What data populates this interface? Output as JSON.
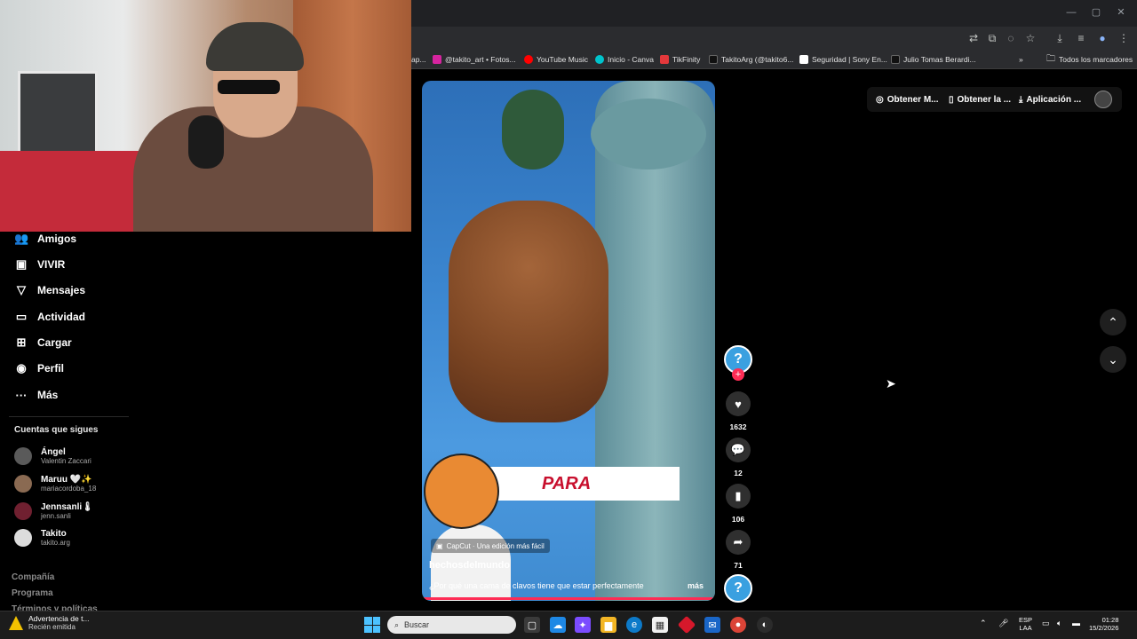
{
  "browser": {
    "bookmarks": [
      {
        "label": "ap...",
        "color": "#5f6368"
      },
      {
        "label": "@takito_art • Fotos...",
        "color": "#d6249f"
      },
      {
        "label": "YouTube Music",
        "color": "#ff0000"
      },
      {
        "label": "Inicio - Canva",
        "color": "#00c4cc"
      },
      {
        "label": "TikFinity",
        "color": "#e3383b"
      },
      {
        "label": "TakitoArg (@takito6...",
        "color": "#111111"
      },
      {
        "label": "Seguridad | Sony En...",
        "color": "#ffffff"
      },
      {
        "label": "Julio Tomas Berardi...",
        "color": "#111111"
      }
    ],
    "bookmarks_more": "»",
    "all_bookmarks": "Todos los marcadores"
  },
  "sidebar": {
    "items": [
      {
        "label": "Amigos",
        "icon": "friends-icon",
        "glyph": "👥"
      },
      {
        "label": "VIVIR",
        "icon": "live-icon",
        "glyph": "▣"
      },
      {
        "label": "Mensajes",
        "icon": "messages-icon",
        "glyph": "▽"
      },
      {
        "label": "Actividad",
        "icon": "activity-icon",
        "glyph": "▭"
      },
      {
        "label": "Cargar",
        "icon": "upload-icon",
        "glyph": "⊞"
      },
      {
        "label": "Perfil",
        "icon": "profile-icon",
        "glyph": "◉"
      },
      {
        "label": "Más",
        "icon": "more-icon",
        "glyph": "···"
      }
    ],
    "following_title": "Cuentas que sigues",
    "following": [
      {
        "name": "Ángel",
        "user": "Valentin Zaccari"
      },
      {
        "name": "Maruu 🤍✨",
        "user": "mariacordoba_18"
      },
      {
        "name": "Jennsanli🌡",
        "user": "jenn.sanli"
      },
      {
        "name": "Takito",
        "user": "takito.arg"
      }
    ],
    "footer": [
      "Compañía",
      "Programa",
      "Términos y políticas"
    ]
  },
  "video": {
    "overlay_text": "PARA",
    "capcut_label": "CapCut · Una edición más fácil",
    "username": "hechosdelmundo",
    "description": "¿Por qué una cama de clavos tiene que estar perfectamente",
    "more": "más",
    "progress": 0.99
  },
  "actions": {
    "likes": "1632",
    "comments": "12",
    "saves": "106",
    "shares": "71"
  },
  "top_actions": {
    "item1": "Obtener M...",
    "item2": "Obtener la ...",
    "item3": "Aplicación ..."
  },
  "taskbar": {
    "notif_title": "Advertencia de t...",
    "notif_sub": "Recién emitida",
    "search_placeholder": "Buscar",
    "lang_line1": "ESP",
    "lang_line2": "LAA",
    "time": "01:28",
    "date": "15/2/2026"
  }
}
